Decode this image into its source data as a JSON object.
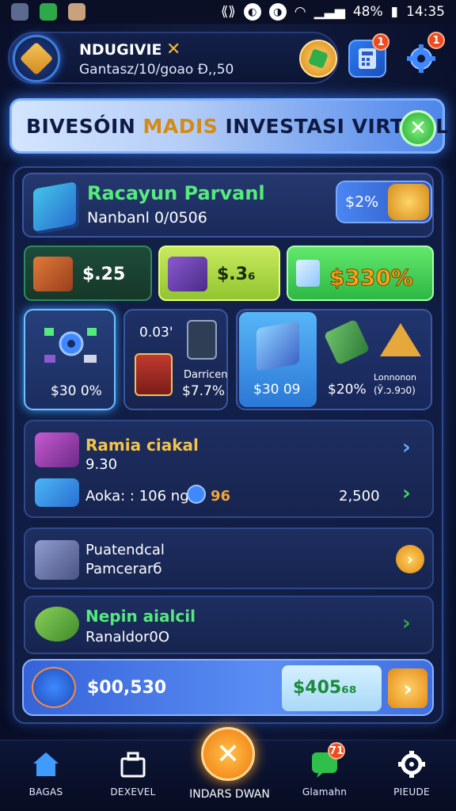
{
  "status_bar": {
    "battery": "48%",
    "time": "14:35"
  },
  "header": {
    "username": "NDUGIVIE",
    "subline": "Gantasz/10/goao Đ,,50",
    "news_badge": "1",
    "settings_badge": "1"
  },
  "banner": {
    "title_part1": "BIVESÓIN ",
    "title_accent": "MADIS",
    "title_part2": " INVESTASI VIRTUAL"
  },
  "summary": {
    "title": "Racayun Parvanl",
    "subtitle": "Nanbanl 0/0506",
    "pill_value": "$2%"
  },
  "tiles": [
    {
      "value": "$.25"
    },
    {
      "value": "$.3₆"
    },
    {
      "value": "$330%"
    }
  ],
  "cards": {
    "card1_value": "$30 0%",
    "card2_top": "0.03'",
    "card2_name": "Darricen",
    "card2_value": "$7.7%",
    "card3_item1": "$30 09",
    "card3_item2": "$20%",
    "card3_item3_name": "Lonnonon",
    "card3_item3_value": "(Ӯ.ᴐ.9ᴐ0)"
  },
  "rows": [
    {
      "title": "Ramia ciakal",
      "sub": "9.30",
      "info": "Aoka: : 106 ngb",
      "info_value": "96",
      "right_value": "2,500"
    },
    {
      "title": "Puatendcal",
      "sub": "Pamcerarб"
    },
    {
      "title": "Nepin aialcil",
      "sub": "Ranaldor0O"
    }
  ],
  "bottom_card": {
    "left_value": "$00,530",
    "box_value": "$405₆₈"
  },
  "nav": {
    "items": [
      "BAGAS",
      "DEXEVEL",
      "INDARS DWAN",
      "Glamahn",
      "PIEUDE"
    ],
    "badge": "71"
  },
  "colors": {
    "accent_green": "#55ea7c",
    "accent_orange": "#f08a14",
    "accent_blue": "#4b86f0"
  }
}
